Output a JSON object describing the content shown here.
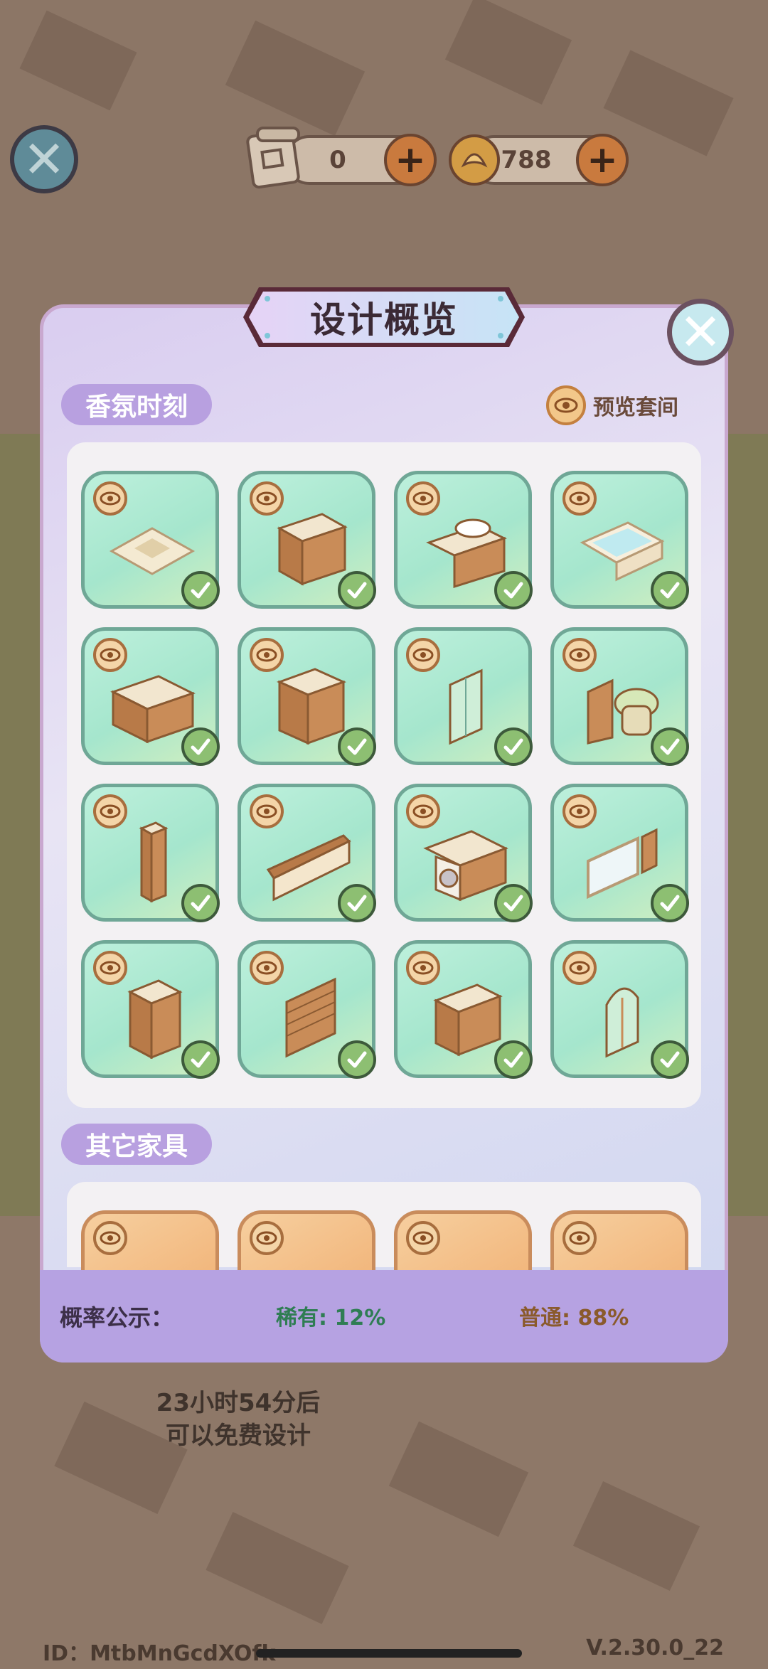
{
  "top_bar": {
    "ticket_count": "0",
    "coin_count": "788",
    "close_icon": "close-icon",
    "add_icon": "plus-icon"
  },
  "background": {
    "free_design_line1": "23小时54分后",
    "free_design_line2": "可以免费设计",
    "player_id": "ID：MtbMnGcdXOfk",
    "version": "V.2.30.0_22"
  },
  "modal": {
    "title": "设计概览",
    "close_icon": "close-icon",
    "section_1": {
      "label": "香氛时刻",
      "preview_label": "预览套间",
      "items": [
        {
          "name": "floor-tile",
          "owned": true
        },
        {
          "name": "cabinet",
          "owned": true
        },
        {
          "name": "sink-vanity",
          "owned": true
        },
        {
          "name": "bathtub",
          "owned": true
        },
        {
          "name": "low-cabinet",
          "owned": true
        },
        {
          "name": "shelf-cabinet",
          "owned": true
        },
        {
          "name": "glass-partition",
          "owned": true
        },
        {
          "name": "toilet",
          "owned": true
        },
        {
          "name": "tall-shelf",
          "owned": true
        },
        {
          "name": "wall-panel",
          "owned": true
        },
        {
          "name": "washing-machine",
          "owned": true
        },
        {
          "name": "mirror",
          "owned": true
        },
        {
          "name": "display-cabinet",
          "owned": true
        },
        {
          "name": "window-blind",
          "owned": true
        },
        {
          "name": "bath-shelf",
          "owned": true
        },
        {
          "name": "shower",
          "owned": true
        }
      ]
    },
    "section_2": {
      "label": "其它家具"
    },
    "probability": {
      "label": "概率公示：",
      "rare": "稀有: 12%",
      "common": "普通: 88%"
    }
  },
  "colors": {
    "rare_tile": "#a5e6cd",
    "common_tile": "#f2b77d",
    "section_tag": "#b8a0e0",
    "probability_bar": "#b6a2e2"
  }
}
